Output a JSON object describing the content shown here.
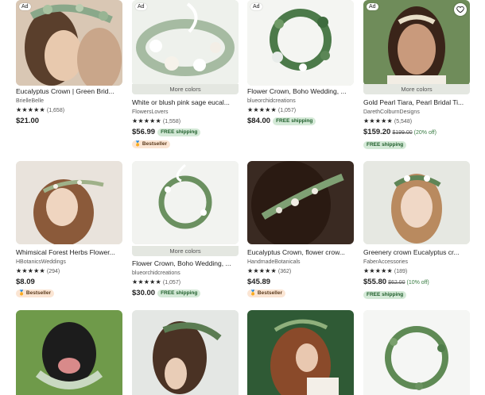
{
  "labels": {
    "ad": "Ad",
    "more_colors": "More colors",
    "free_shipping": "FREE shipping",
    "bestseller": "Bestseller",
    "stars": "★★★★★"
  },
  "colors": {
    "accent_green": "#d4e9d7",
    "bestseller_bg": "#fbe5d3",
    "text": "#222222"
  },
  "listings": [
    {
      "title": "Eucalyptus Crown | Green Brid...",
      "shop": "BrielleBelle",
      "reviews": "(1,658)",
      "price": "$21.00"
    },
    {
      "title": "White or blush pink sage eucal...",
      "shop": "FlowersLovers",
      "reviews": "(1,558)",
      "price": "$56.99"
    },
    {
      "title": "Flower Crown, Boho Wedding, ...",
      "shop": "blueorchidcreations",
      "reviews": "(1,057)",
      "price": "$84.00"
    },
    {
      "title": "Gold Pearl Tiara, Pearl Bridal Ti...",
      "shop": "DarethColburnDesigns",
      "reviews": "(5,548)",
      "price": "$159.20",
      "original_price": "$199.00",
      "discount": "(20% off)"
    },
    {
      "title": "Whimsical Forest Herbs Flower...",
      "shop": "HBotanicsWeddings",
      "reviews": "(294)",
      "price": "$8.09"
    },
    {
      "title": "Flower Crown, Boho Wedding, ...",
      "shop": "blueorchidcreations",
      "reviews": "(1,057)",
      "price": "$30.00"
    },
    {
      "title": "Eucalyptus Crown, flower crow...",
      "shop": "HandmadeBotanicals",
      "reviews": "(362)",
      "price": "$45.89"
    },
    {
      "title": "Greenery crown Eucalyptus cr...",
      "shop": "FaberAccessories",
      "reviews": "(189)",
      "price": "$55.80",
      "original_price": "$62.00",
      "discount": "(10% off)"
    }
  ]
}
